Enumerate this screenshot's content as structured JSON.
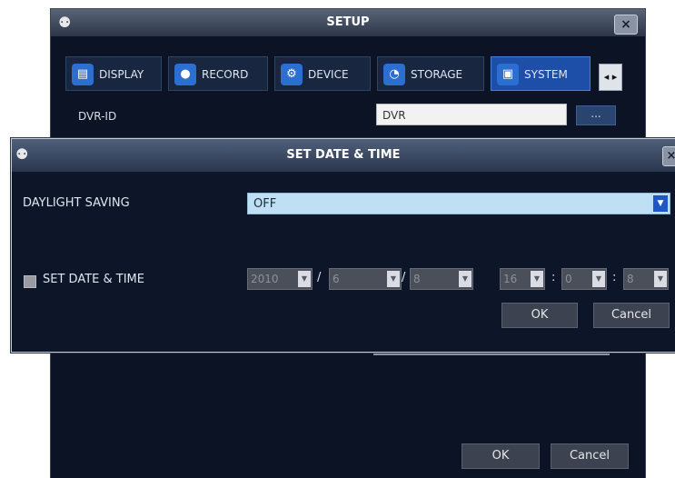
{
  "setup": {
    "title": "SETUP",
    "close": "×",
    "tabs": [
      {
        "label": "DISPLAY",
        "icon": "display-icon",
        "glyph": "▤"
      },
      {
        "label": "RECORD",
        "icon": "record-icon",
        "glyph": "●"
      },
      {
        "label": "DEVICE",
        "icon": "gear-icon",
        "glyph": "⚙"
      },
      {
        "label": "STORAGE",
        "icon": "disk-icon",
        "glyph": "◔"
      },
      {
        "label": "SYSTEM",
        "icon": "computer-icon",
        "glyph": "▣"
      }
    ],
    "tab_more": "◂ ▸",
    "dvr_id_label": "DVR-ID",
    "dvr_id_value": "DVR",
    "dvr_id_button": "...",
    "ok": "OK",
    "cancel": "Cancel"
  },
  "dialog": {
    "title": "SET DATE & TIME",
    "close": "×",
    "daylight_saving_label": "DAYLIGHT SAVING",
    "daylight_saving_value": "OFF",
    "set_date_time_label": "SET DATE & TIME",
    "set_date_time_checked": false,
    "date": {
      "year": "2010",
      "month": "6",
      "day": "8"
    },
    "time": {
      "hour": "16",
      "minute": "0",
      "second": "8"
    },
    "date_sep": "/",
    "time_sep": ":",
    "ok": "OK",
    "cancel": "Cancel"
  },
  "colors": {
    "window_bg": "#0c1324",
    "accent_blue": "#1d4fa8",
    "select_bg": "#bfe0f4"
  }
}
